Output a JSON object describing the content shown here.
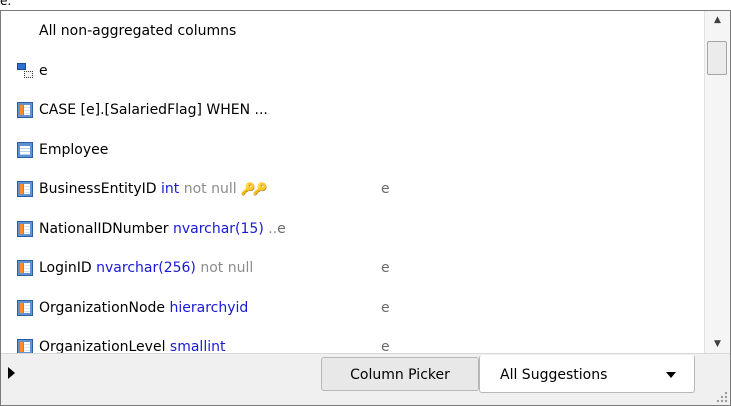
{
  "editor": {
    "typed_prefix": "e."
  },
  "suggestions": {
    "header": "All non-aggregated columns",
    "items": [
      {
        "icon": "alias-icon",
        "name": "e"
      },
      {
        "icon": "column-icon",
        "name": "CASE [e].[SalariedFlag] WHEN ..."
      },
      {
        "icon": "table-icon",
        "name": "Employee"
      },
      {
        "icon": "column-icon",
        "name": "BusinessEntityID",
        "type": "int",
        "nullability": "not null",
        "keys": [
          "primary-key-icon",
          "foreign-key-icon"
        ],
        "owner": "e"
      },
      {
        "icon": "column-icon",
        "name": "NationalIDNumber",
        "type": "nvarchar(15)",
        "nullability": "..",
        "owner": "e"
      },
      {
        "icon": "column-icon",
        "name": "LoginID",
        "type": "nvarchar(256)",
        "nullability": "not null",
        "owner": "e"
      },
      {
        "icon": "column-icon",
        "name": "OrganizationNode",
        "type": "hierarchyid",
        "owner": "e"
      },
      {
        "icon": "column-icon",
        "name": "OrganizationLevel",
        "type": "smallint",
        "owner": "e"
      }
    ]
  },
  "scrollbar": {
    "up_icon": "scroll-up-arrow",
    "down_icon": "scroll-down-arrow"
  },
  "footer": {
    "expand_icon": "expand-triangle-icon",
    "tabs": {
      "column_picker": "Column Picker",
      "all_suggestions": "All Suggestions"
    },
    "dropdown_icon": "dropdown-arrow-icon",
    "grip_icon": "resize-grip-icon"
  },
  "colors": {
    "keyword": "#1818d8",
    "muted": "#8c8c8c"
  }
}
